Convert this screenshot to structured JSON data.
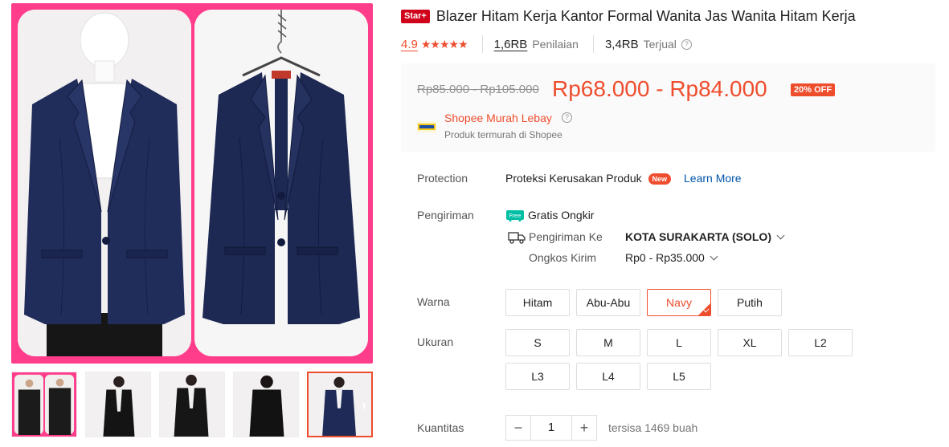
{
  "gallery": {
    "thumbnails": [
      {
        "name": "thumb-1",
        "active": false
      },
      {
        "name": "thumb-2",
        "active": false
      },
      {
        "name": "thumb-3",
        "active": false
      },
      {
        "name": "thumb-4",
        "active": false
      },
      {
        "name": "thumb-5",
        "active": true
      }
    ],
    "next_arrow": "›"
  },
  "product": {
    "badge": "Star+",
    "title": "Blazer Hitam Kerja Kantor Formal Wanita Jas Wanita Hitam Kerja",
    "rating": "4.9",
    "stars": "★★★★★",
    "reviews_count": "1,6RB",
    "reviews_label": "Penilaian",
    "sold_count": "3,4RB",
    "sold_label": "Terjual"
  },
  "price": {
    "original": "Rp85.000 - Rp105.000",
    "current": "Rp68.000 - Rp84.000",
    "discount": "20% OFF",
    "promo_title": "Shopee Murah Lebay",
    "promo_subtitle": "Produk termurah di Shopee"
  },
  "protection": {
    "label": "Protection",
    "value": "Proteksi Kerusakan Produk",
    "badge": "New",
    "link": "Learn More"
  },
  "shipping": {
    "label": "Pengiriman",
    "free_label": "Gratis Ongkir",
    "free_icon_text": "Free",
    "to_label": "Pengiriman Ke",
    "to_value": "KOTA SURAKARTA (SOLO)",
    "cost_label": "Ongkos Kirim",
    "cost_value": "Rp0 - Rp35.000"
  },
  "color": {
    "label": "Warna",
    "options": [
      "Hitam",
      "Abu-Abu",
      "Navy",
      "Putih"
    ],
    "selected": "Navy"
  },
  "size": {
    "label": "Ukuran",
    "options": [
      "S",
      "M",
      "L",
      "XL",
      "L2",
      "L3",
      "L4",
      "L5"
    ]
  },
  "quantity": {
    "label": "Kuantitas",
    "value": "1",
    "minus": "−",
    "plus": "+",
    "stock": "tersisa 1469 buah"
  },
  "colors": {
    "accent": "#ee4d2d",
    "gallery_bg": "#ff3d8b",
    "blazer_navy": "#1f2a56",
    "link": "#0055aa"
  }
}
